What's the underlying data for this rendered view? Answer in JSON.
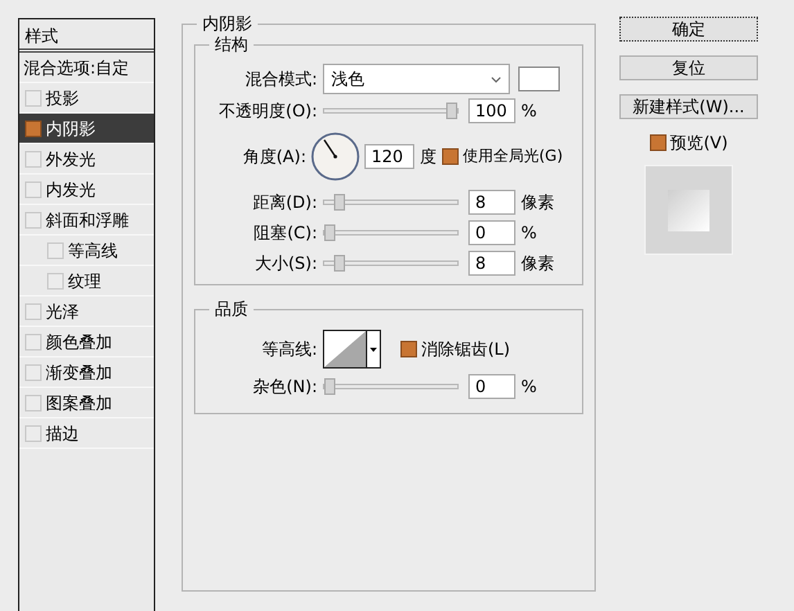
{
  "sidebar": {
    "header": "样式",
    "blend_options": "混合选项:自定",
    "items": [
      {
        "label": "投影",
        "checked": false,
        "selected": false
      },
      {
        "label": "内阴影",
        "checked": true,
        "selected": true
      },
      {
        "label": "外发光",
        "checked": false,
        "selected": false
      },
      {
        "label": "内发光",
        "checked": false,
        "selected": false
      },
      {
        "label": "斜面和浮雕",
        "checked": false,
        "selected": false,
        "children": [
          {
            "label": "等高线",
            "checked": false,
            "selected": false
          },
          {
            "label": "纹理",
            "checked": false,
            "selected": false
          }
        ]
      },
      {
        "label": "光泽",
        "checked": false,
        "selected": false
      },
      {
        "label": "颜色叠加",
        "checked": false,
        "selected": false
      },
      {
        "label": "渐变叠加",
        "checked": false,
        "selected": false
      },
      {
        "label": "图案叠加",
        "checked": false,
        "selected": false
      },
      {
        "label": "描边",
        "checked": false,
        "selected": false
      }
    ]
  },
  "panel": {
    "title": "内阴影",
    "structure": {
      "title": "结构",
      "blend_mode": {
        "label": "混合模式:",
        "value": "浅色"
      },
      "opacity": {
        "label": "不透明度(O):",
        "level": 1,
        "value": "100",
        "unit": "%"
      },
      "angle": {
        "label": "角度(A):",
        "value": "120",
        "unit": "度",
        "global_light": {
          "label": "使用全局光(G)",
          "checked": true
        }
      },
      "sliders": [
        {
          "label": "距离(D):",
          "level": 0.08,
          "value": "8",
          "unit": "像素"
        },
        {
          "label": "阻塞(C):",
          "level": 0,
          "value": "0",
          "unit": "%"
        },
        {
          "label": "大小(S):",
          "level": 0.08,
          "value": "8",
          "unit": "像素"
        }
      ]
    },
    "quality": {
      "title": "品质",
      "contour_label": "等高线:",
      "anti_alias": {
        "label": "消除锯齿(L)",
        "checked": true
      },
      "noise": {
        "label": "杂色(N):",
        "level": 0,
        "value": "0",
        "unit": "%"
      }
    }
  },
  "buttons": [
    {
      "label": "确定",
      "default": true
    },
    {
      "label": "复位",
      "default": false
    },
    {
      "label": "新建样式(W)...",
      "default": false
    }
  ],
  "preview": {
    "label": "预览(V)",
    "checked": true
  }
}
